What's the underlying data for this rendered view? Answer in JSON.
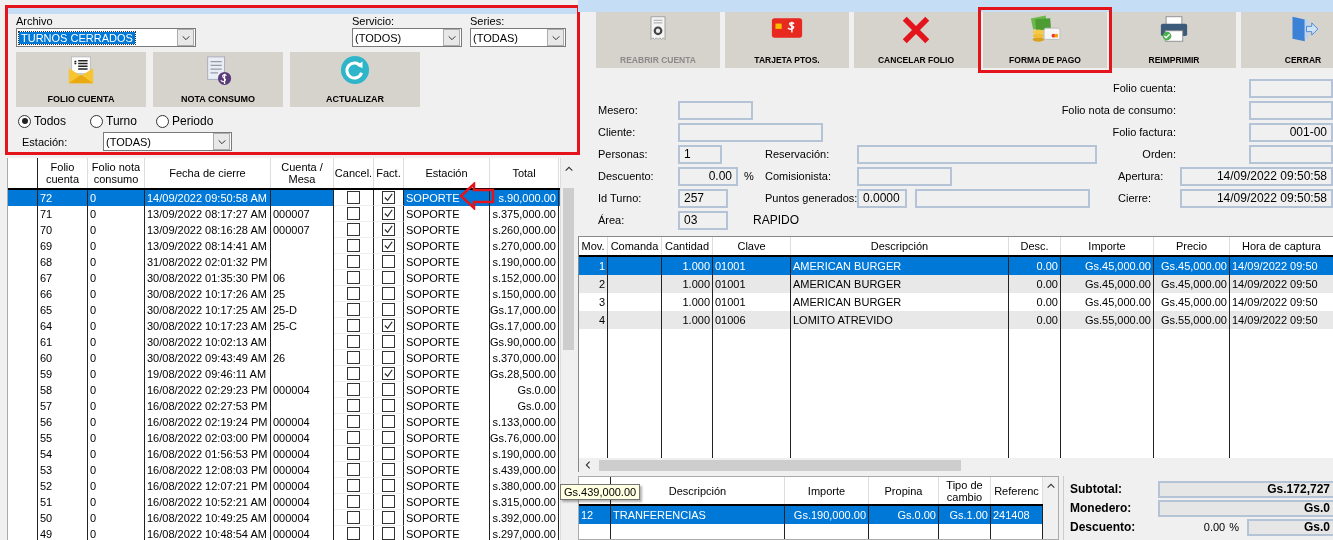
{
  "annotations": {
    "filter_panel_frame": true,
    "row_arrow": true
  },
  "filters": {
    "archivo": {
      "label": "Archivo",
      "value": "TURNOS CERRADOS"
    },
    "servicio": {
      "label": "Servicio:",
      "value": "(TODOS)"
    },
    "series": {
      "label": "Series:",
      "value": "(TODAS)"
    }
  },
  "filter_buttons": [
    {
      "label": "FOLIO CUENTA"
    },
    {
      "label": "NOTA CONSUMO"
    },
    {
      "label": "ACTUALIZAR"
    }
  ],
  "scope_options": [
    {
      "label": "Todos",
      "selected": true
    },
    {
      "label": "Turno",
      "selected": false
    },
    {
      "label": "Periodo",
      "selected": false
    }
  ],
  "estacion_filter": {
    "label": "Estación:",
    "value": "(TODAS)"
  },
  "accounts_table": {
    "columns": [
      "Folio cuenta",
      "Folio nota consumo",
      "Fecha de cierre",
      "Cuenta / Mesa",
      "Cancel.",
      "Fact.",
      "Estación",
      "Total"
    ],
    "rows": [
      {
        "folio": "72",
        "nota": "0",
        "fecha": "14/09/2022 09:50:58 AM",
        "cancelled": false,
        "invoiced": true,
        "estacion": "SOPORTE",
        "total": "s.90,000.00",
        "selected": true
      },
      {
        "folio": "71",
        "nota": "0",
        "fecha": "13/09/2022 08:17:27 AM",
        "cuenta": "000007",
        "cancelled": false,
        "invoiced": true,
        "estacion": "SOPORTE",
        "total": "s.375,000.00",
        "selected": false
      },
      {
        "folio": "70",
        "nota": "0",
        "fecha": "13/09/2022 08:16:28 AM",
        "cuenta": "000007",
        "cancelled": false,
        "invoiced": true,
        "estacion": "SOPORTE",
        "total": "s.260,000.00",
        "selected": false
      },
      {
        "folio": "69",
        "nota": "0",
        "fecha": "13/09/2022 08:14:41 AM",
        "cancelled": false,
        "invoiced": true,
        "estacion": "SOPORTE",
        "total": "s.270,000.00",
        "selected": false
      },
      {
        "folio": "68",
        "nota": "0",
        "fecha": "31/08/2022 02:01:32 PM",
        "cancelled": false,
        "invoiced": false,
        "estacion": "SOPORTE",
        "total": "s.190,000.00",
        "selected": false
      },
      {
        "folio": "67",
        "nota": "0",
        "fecha": "30/08/2022 01:35:30 PM",
        "cuenta": "06",
        "cancelled": false,
        "invoiced": false,
        "estacion": "SOPORTE",
        "total": "s.152,000.00",
        "selected": false
      },
      {
        "folio": "66",
        "nota": "0",
        "fecha": "30/08/2022 10:17:26 AM",
        "cuenta": "25",
        "cancelled": false,
        "invoiced": false,
        "estacion": "SOPORTE",
        "total": "s.150,000.00",
        "selected": false
      },
      {
        "folio": "65",
        "nota": "0",
        "fecha": "30/08/2022 10:17:25 AM",
        "cuenta": "25-D",
        "cancelled": false,
        "invoiced": false,
        "estacion": "SOPORTE",
        "total": "Gs.17,000.00",
        "selected": false
      },
      {
        "folio": "64",
        "nota": "0",
        "fecha": "30/08/2022 10:17:23 AM",
        "cuenta": "25-C",
        "cancelled": false,
        "invoiced": true,
        "estacion": "SOPORTE",
        "total": "Gs.17,000.00",
        "selected": false
      },
      {
        "folio": "61",
        "nota": "0",
        "fecha": "30/08/2022 10:02:13 AM",
        "cancelled": false,
        "invoiced": false,
        "estacion": "SOPORTE",
        "total": "Gs.90,000.00",
        "selected": false
      },
      {
        "folio": "60",
        "nota": "0",
        "fecha": "30/08/2022 09:43:49 AM",
        "cuenta": "26",
        "cancelled": false,
        "invoiced": false,
        "estacion": "SOPORTE",
        "total": "s.370,000.00",
        "selected": false
      },
      {
        "folio": "59",
        "nota": "0",
        "fecha": "19/08/2022 09:46:11 AM",
        "cancelled": false,
        "invoiced": true,
        "estacion": "SOPORTE",
        "total": "Gs.28,500.00",
        "selected": false
      },
      {
        "folio": "58",
        "nota": "0",
        "fecha": "16/08/2022 02:29:23 PM",
        "cuenta": "000004",
        "cancelled": false,
        "invoiced": false,
        "estacion": "SOPORTE",
        "total": "Gs.0.00",
        "selected": false
      },
      {
        "folio": "57",
        "nota": "0",
        "fecha": "16/08/2022 02:27:53 PM",
        "cancelled": false,
        "invoiced": false,
        "estacion": "SOPORTE",
        "total": "Gs.0.00",
        "selected": false
      },
      {
        "folio": "56",
        "nota": "0",
        "fecha": "16/08/2022 02:19:24 PM",
        "cuenta": "000004",
        "cancelled": false,
        "invoiced": false,
        "estacion": "SOPORTE",
        "total": "s.133,000.00",
        "selected": false
      },
      {
        "folio": "55",
        "nota": "0",
        "fecha": "16/08/2022 02:03:00 PM",
        "cuenta": "000004",
        "cancelled": false,
        "invoiced": false,
        "estacion": "SOPORTE",
        "total": "Gs.76,000.00",
        "selected": false
      },
      {
        "folio": "54",
        "nota": "0",
        "fecha": "16/08/2022 01:56:53 PM",
        "cuenta": "000004",
        "cancelled": false,
        "invoiced": false,
        "estacion": "SOPORTE",
        "total": "s.190,000.00",
        "selected": false
      },
      {
        "folio": "53",
        "nota": "0",
        "fecha": "16/08/2022 12:08:03 PM",
        "cuenta": "000004",
        "cancelled": false,
        "invoiced": false,
        "estacion": "SOPORTE",
        "total": "s.439,000.00",
        "selected": false
      },
      {
        "folio": "52",
        "nota": "0",
        "fecha": "16/08/2022 12:07:21 PM",
        "cuenta": "000004",
        "cancelled": false,
        "invoiced": false,
        "estacion": "SOPORTE",
        "total": "s.380,000.00",
        "selected": false
      },
      {
        "folio": "51",
        "nota": "0",
        "fecha": "16/08/2022 10:52:21 AM",
        "cuenta": "000004",
        "cancelled": false,
        "invoiced": false,
        "estacion": "SOPORTE",
        "total": "s.315,000.00",
        "selected": false
      },
      {
        "folio": "50",
        "nota": "0",
        "fecha": "16/08/2022 10:49:25 AM",
        "cuenta": "000004",
        "cancelled": false,
        "invoiced": false,
        "estacion": "SOPORTE",
        "total": "s.392,000.00",
        "selected": false
      },
      {
        "folio": "49",
        "nota": "0",
        "fecha": "16/08/2022 10:48:54 AM",
        "cuenta": "000004",
        "cancelled": false,
        "invoiced": false,
        "estacion": "SOPORTE",
        "total": "s.297,000.00",
        "selected": false
      }
    ]
  },
  "tooltip": "Gs.439,000.00",
  "toolbar": [
    {
      "label": "REABRIR CUENTA",
      "disabled": true,
      "highlighted": false
    },
    {
      "label": "TARJETA PTOS.",
      "disabled": false,
      "highlighted": false
    },
    {
      "label": "CANCELAR FOLIO",
      "disabled": false,
      "highlighted": false
    },
    {
      "label": "FORMA DE PAGO",
      "disabled": false,
      "highlighted": true
    },
    {
      "label": "REIMPRIMIR",
      "disabled": false,
      "highlighted": false
    },
    {
      "label": "CERRAR",
      "disabled": false,
      "highlighted": false
    }
  ],
  "form": {
    "folio_cuenta": {
      "label": "Folio cuenta:"
    },
    "mesero": {
      "label": "Mesero:"
    },
    "folio_nota": {
      "label": "Folio nota de consumo:"
    },
    "cliente": {
      "label": "Cliente:"
    },
    "folio_factura": {
      "label": "Folio factura:",
      "value": "001-00"
    },
    "personas": {
      "label": "Personas:",
      "value": "1"
    },
    "reservacion": {
      "label": "Reservación:"
    },
    "orden": {
      "label": "Orden:"
    },
    "descuento": {
      "label": "Descuento:",
      "value": "0.00",
      "unit": "%"
    },
    "comisionista": {
      "label": "Comisionista:"
    },
    "apertura": {
      "label": "Apertura:",
      "value": "14/09/2022 09:50:58"
    },
    "id_turno": {
      "label": "Id Turno:",
      "value": "257"
    },
    "puntos": {
      "label": "Puntos generados:",
      "value": "0.0000"
    },
    "cierre": {
      "label": "Cierre:",
      "value": "14/09/2022 09:50:58"
    },
    "area": {
      "label": "Área:",
      "value": "03",
      "name": "RAPIDO"
    }
  },
  "items_table": {
    "columns": [
      "Mov.",
      "Comanda",
      "Cantidad",
      "Clave",
      "Descripción",
      "Desc.",
      "Importe",
      "Precio",
      "Hora de captura"
    ],
    "rows": [
      {
        "mov": "1",
        "cantidad": "1.000",
        "clave": "01001",
        "descripcion": "AMERICAN BURGER",
        "desc": "0.00",
        "importe": "Gs.45,000.00",
        "precio": "Gs.45,000.00",
        "hora": "14/09/2022 09:50",
        "selected": true
      },
      {
        "mov": "2",
        "cantidad": "1.000",
        "clave": "01001",
        "descripcion": "AMERICAN BURGER",
        "desc": "0.00",
        "importe": "Gs.45,000.00",
        "precio": "Gs.45,000.00",
        "hora": "14/09/2022 09:50",
        "selected": false
      },
      {
        "mov": "3",
        "cantidad": "1.000",
        "clave": "01001",
        "descripcion": "AMERICAN BURGER",
        "desc": "0.00",
        "importe": "Gs.45,000.00",
        "precio": "Gs.45,000.00",
        "hora": "14/09/2022 09:50",
        "selected": false
      },
      {
        "mov": "4",
        "cantidad": "1.000",
        "clave": "01006",
        "descripcion": "LOMITO ATREVIDO",
        "desc": "0.00",
        "importe": "Gs.55,000.00",
        "precio": "Gs.55,000.00",
        "hora": "14/09/2022 09:50",
        "selected": false
      }
    ]
  },
  "payments_table": {
    "columns": [
      "Descripción",
      "Importe",
      "Propina",
      "Tipo de cambio",
      "Referenc"
    ],
    "rows": [
      {
        "column_1": "12",
        "descripcion": "TRANFERENCIAS",
        "importe": "Gs.190,000.00",
        "propina": "Gs.0.00",
        "tipo_cambio": "Gs.1.00",
        "referencia": "241408",
        "selected": true
      }
    ]
  },
  "totals": {
    "subtotal": {
      "label": "Subtotal:",
      "value": "Gs.172,727"
    },
    "monedero": {
      "label": "Monedero:",
      "value": "Gs.0"
    },
    "descuento": {
      "label": "Descuento:",
      "percent": "0.00",
      "unit": "%",
      "value": "Gs.0"
    }
  }
}
